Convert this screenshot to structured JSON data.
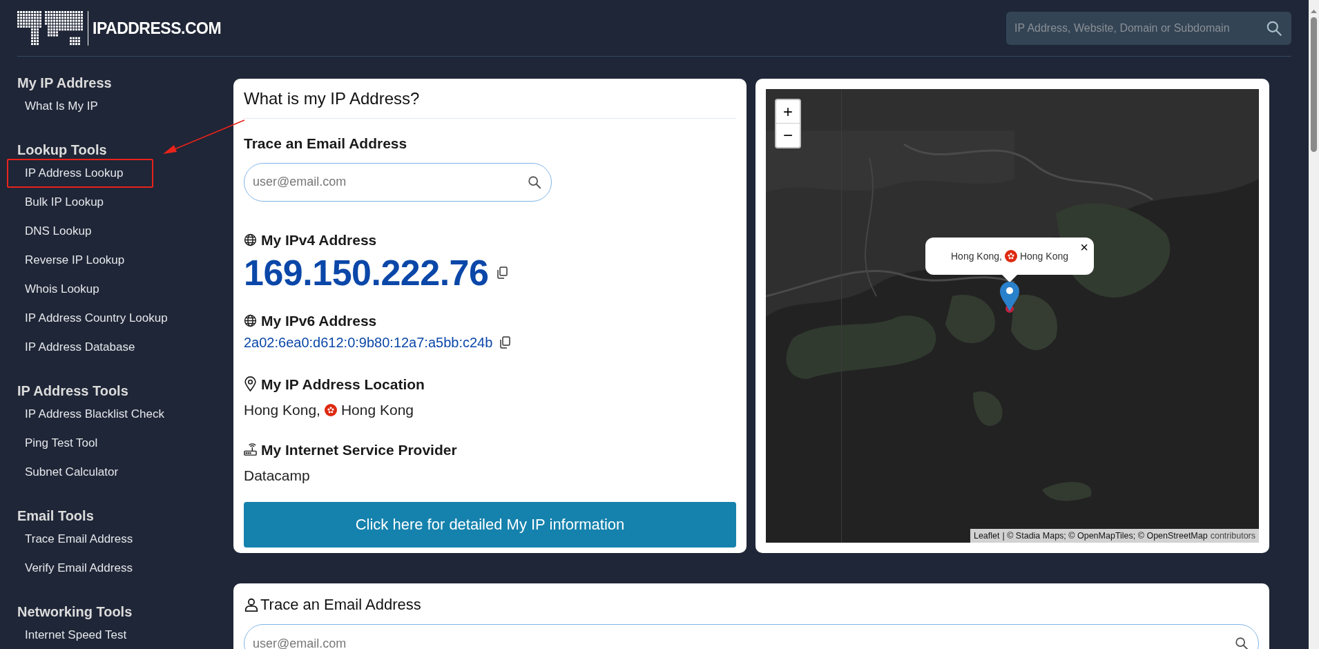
{
  "header": {
    "logo_text": "IPADDRESS.COM",
    "search": {
      "placeholder": "IP Address, Website, Domain or Subdomain"
    }
  },
  "sidebar": {
    "groups": [
      {
        "heading": "My IP Address",
        "items": [
          {
            "label": "What Is My IP",
            "selected": false
          }
        ]
      },
      {
        "heading": "Lookup Tools",
        "items": [
          {
            "label": "IP Address Lookup",
            "selected": true
          },
          {
            "label": "Bulk IP Lookup",
            "selected": false
          },
          {
            "label": "DNS Lookup",
            "selected": false
          },
          {
            "label": "Reverse IP Lookup",
            "selected": false
          },
          {
            "label": "Whois Lookup",
            "selected": false
          },
          {
            "label": "IP Address Country Lookup",
            "selected": false
          },
          {
            "label": "IP Address Database",
            "selected": false
          }
        ]
      },
      {
        "heading": "IP Address Tools",
        "items": [
          {
            "label": "IP Address Blacklist Check",
            "selected": false
          },
          {
            "label": "Ping Test Tool",
            "selected": false
          },
          {
            "label": "Subnet Calculator",
            "selected": false
          }
        ]
      },
      {
        "heading": "Email Tools",
        "items": [
          {
            "label": "Trace Email Address",
            "selected": false
          },
          {
            "label": "Verify Email Address",
            "selected": false
          }
        ]
      },
      {
        "heading": "Networking Tools",
        "items": [
          {
            "label": "Internet Speed Test",
            "selected": false
          }
        ]
      }
    ]
  },
  "ip_card": {
    "title": "What is my IP Address?",
    "email_trace": {
      "heading": "Trace an Email Address",
      "placeholder": "user@email.com"
    },
    "ipv4": {
      "label": "My IPv4 Address",
      "value": "169.150.222.76"
    },
    "ipv6": {
      "label": "My IPv6 Address",
      "value": "2a02:6ea0:d612:0:9b80:12a7:a5bb:c24b"
    },
    "location": {
      "label": "My IP Address Location",
      "city": "Hong Kong,",
      "country": "Hong Kong"
    },
    "isp": {
      "label": "My Internet Service Provider",
      "value": "Datacamp"
    },
    "button": "Click here for detailed My IP information"
  },
  "map": {
    "zoom_in": "+",
    "zoom_out": "−",
    "popup": {
      "city": "Hong Kong,",
      "country": "Hong Kong",
      "close": "×"
    },
    "attribution": {
      "link": "Leaflet",
      "text": "| © Stadia Maps; © OpenMapTiles; © OpenStreetMap",
      "link2": "contributors"
    }
  },
  "email_card": {
    "title": "Trace an Email Address",
    "placeholder": "user@email.com"
  }
}
